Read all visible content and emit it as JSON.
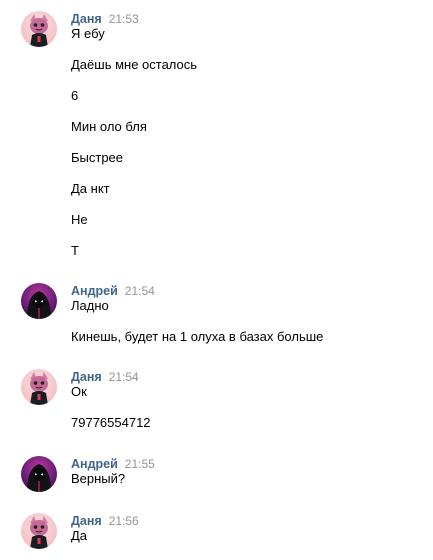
{
  "messages": [
    {
      "author": "Даня",
      "time": "21:53",
      "avatar_icon": "pink-cat-avatar",
      "lines": [
        "Я ебу",
        "Даёшь мне осталось",
        "6",
        "Мин оло бля",
        "Быстрее",
        "Да нкт",
        "Не",
        "Т"
      ]
    },
    {
      "author": "Андрей",
      "time": "21:54",
      "avatar_icon": "hooded-figure-avatar",
      "lines": [
        "Ладно",
        "Кинешь, будет на 1 олуха в базах больше"
      ]
    },
    {
      "author": "Даня",
      "time": "21:54",
      "avatar_icon": "pink-cat-avatar",
      "lines": [
        "Ок",
        "79776554712"
      ]
    },
    {
      "author": "Андрей",
      "time": "21:55",
      "avatar_icon": "hooded-figure-avatar",
      "lines": [
        "Верный?"
      ]
    },
    {
      "author": "Даня",
      "time": "21:56",
      "avatar_icon": "pink-cat-avatar",
      "lines": [
        "Да"
      ]
    }
  ],
  "colors": {
    "author_name": "#42648b",
    "timestamp": "#939393",
    "message_text": "#000000",
    "background": "#ffffff"
  }
}
